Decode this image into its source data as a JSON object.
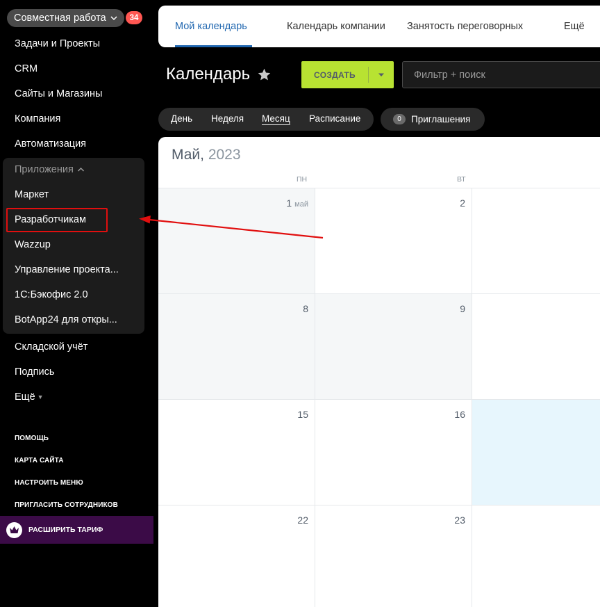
{
  "sidebar": {
    "group_label": "Совместная работа",
    "badge_count": "34",
    "items_top": [
      "Задачи и Проекты",
      "CRM",
      "Сайты и Магазины",
      "Компания",
      "Автоматизация"
    ],
    "apps_header": "Приложения",
    "apps": [
      "Маркет",
      "Разработчикам",
      "Wazzup",
      "Управление проекта...",
      "1С:Бэкофис 2.0",
      "BotApp24 для откры..."
    ],
    "items_bottom": [
      "Складской учёт",
      "Подпись",
      "Ещё"
    ],
    "links": [
      "ПОМОЩЬ",
      "КАРТА САЙТА",
      "НАСТРОИТЬ МЕНЮ",
      "ПРИГЛАСИТЬ СОТРУДНИКОВ"
    ],
    "upgrade_label": "РАСШИРИТЬ ТАРИФ"
  },
  "tabs": [
    "Мой календарь",
    "Календарь компании",
    "Занятость переговорных",
    "Ещё"
  ],
  "title": "Календарь",
  "create_label": "СОЗДАТЬ",
  "search_placeholder": "Фильтр + поиск",
  "views": [
    "День",
    "Неделя",
    "Месяц",
    "Расписание"
  ],
  "invites": {
    "count": "0",
    "label": "Приглашения"
  },
  "calendar": {
    "month": "Май,",
    "year": "2023",
    "weekdays": [
      "ПН",
      "ВТ"
    ],
    "days": [
      [
        "1",
        "2",
        ""
      ],
      [
        "8",
        "9",
        ""
      ],
      [
        "15",
        "16",
        ""
      ],
      [
        "22",
        "23",
        ""
      ]
    ],
    "first_day_suffix": "май"
  },
  "colors": {
    "accent_blue": "#2067b0",
    "create_green": "#b8e232",
    "badge_red": "#ff5752",
    "highlight_red": "#e10f0f",
    "upgrade_purple": "#3b0b47"
  }
}
